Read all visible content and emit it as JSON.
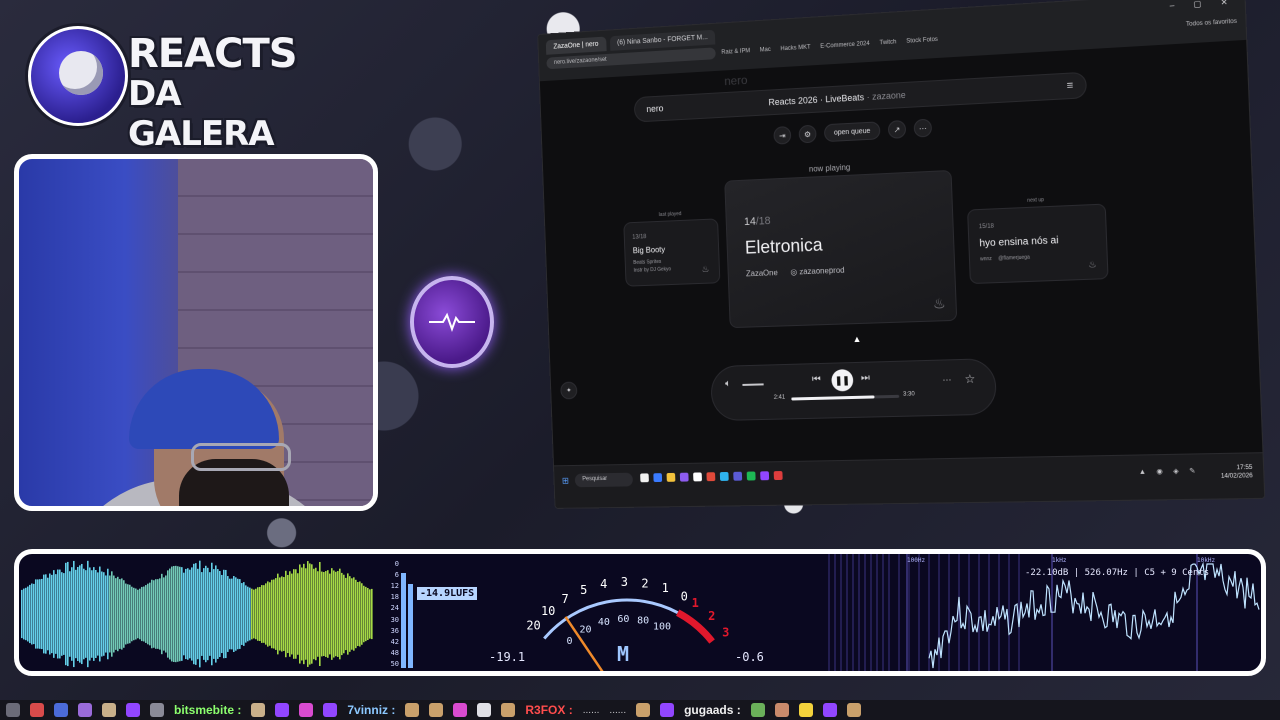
{
  "logo": {
    "line1": "REACTS",
    "line2": "DA GALERA"
  },
  "browser": {
    "tabs": [
      "ZazaOne | nero",
      "(6) Nina Sanbo - FORGET M..."
    ],
    "address": "nero.live/zazaone/set",
    "bookmarks": [
      "Raiz & IPM",
      "Mac",
      "Hacks MKT",
      "E-Commerce 2024",
      "Twitch",
      "Stock Fotos"
    ],
    "favorites_label": "Todos os favoritos",
    "window_controls": "– ▢ ✕"
  },
  "app": {
    "watermark": "nero",
    "brand": "nero",
    "title": "Reacts 2026 · LiveBeats",
    "title_sep": "·",
    "user": "zazaone",
    "open_queue": "open queue",
    "now_playing": "now playing",
    "last_played_label": "last played",
    "next_up_label": "next up",
    "prev_track": {
      "pos": "13/18",
      "title": "Big Booty",
      "artist": "Beats Sprites",
      "sub": "Instr by DJ Gekyo"
    },
    "current_track": {
      "pos_num": "14",
      "pos_total": "/18",
      "title": "Eletronica",
      "artist": "ZazaOne",
      "handle": "zazaoneprod"
    },
    "next_track": {
      "pos": "15/18",
      "title": "hyo ensina nós ai",
      "artist": "wnnz",
      "handle": "@flamerjuega"
    },
    "player": {
      "elapsed": "2:41",
      "total": "3:30",
      "progress": 0.77
    }
  },
  "taskbar": {
    "search": "Pesquisar",
    "time": "17:55",
    "date": "14/02/2026"
  },
  "meters": {
    "lufs_scale": [
      "0",
      "6",
      "12",
      "18",
      "24",
      "30",
      "36",
      "42",
      "48",
      "50"
    ],
    "lufs_value": "-14.9LUFS",
    "vu_scale_black": [
      "20",
      "10",
      "7",
      "5",
      "4",
      "3",
      "2",
      "1",
      "0"
    ],
    "vu_scale_red": [
      "1",
      "2",
      "3"
    ],
    "vu_scale_inner": [
      "0",
      "20",
      "40",
      "60",
      "80",
      "100"
    ],
    "vu_left": "-19.1",
    "vu_right": "-0.6",
    "vu_mode": "M",
    "spectrum_info": "-22.10dB | 526.07Hz | C5 + 9 Cents",
    "hz_labels": [
      "100Hz",
      "1kHz",
      "10kHz"
    ]
  },
  "chat": [
    {
      "name": "bitsmebite",
      "sep": ":"
    },
    {
      "name": "7vinniz",
      "sep": ":"
    },
    {
      "name": "R3FOX",
      "sep": ":"
    },
    {
      "name": "gugaads",
      "sep": ":"
    }
  ],
  "chat_dots": [
    "......",
    "......"
  ],
  "colors": {
    "accent_purple": "#8b4bd8",
    "vu_red": "#e0182c",
    "wave_cyan": "#6ee7ff",
    "wave_green": "#b6f24a"
  }
}
